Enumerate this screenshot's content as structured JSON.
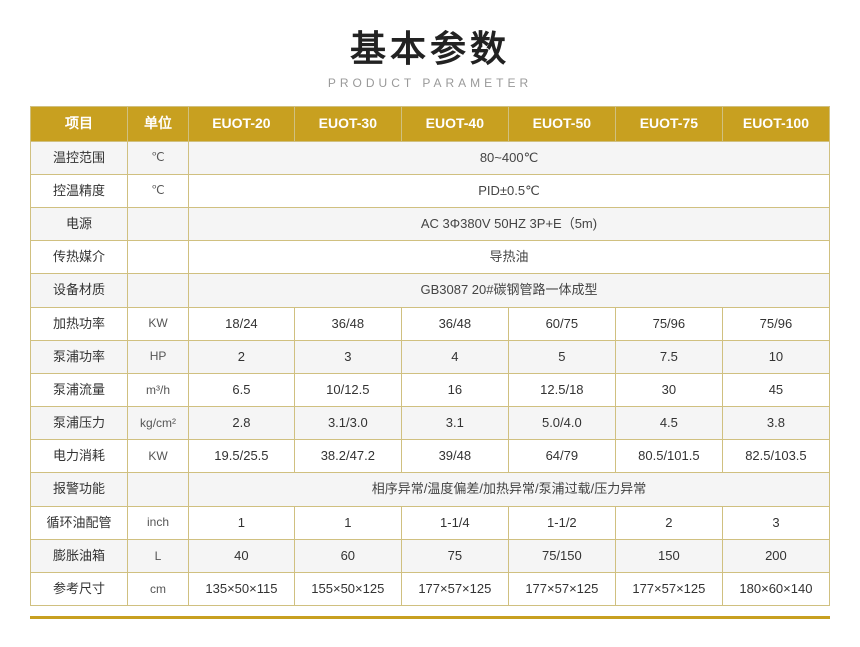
{
  "title": {
    "main": "基本参数",
    "sub": "PRODUCT PARAMETER"
  },
  "table": {
    "headers": [
      "项目",
      "单位",
      "EUOT-20",
      "EUOT-30",
      "EUOT-40",
      "EUOT-50",
      "EUOT-75",
      "EUOT-100"
    ],
    "rows": [
      {
        "label": "温控范围",
        "unit": "℃",
        "span": true,
        "spanValue": "80~400℃"
      },
      {
        "label": "控温精度",
        "unit": "℃",
        "span": true,
        "spanValue": "PID±0.5℃"
      },
      {
        "label": "电源",
        "unit": "",
        "span": true,
        "spanValue": "AC 3Φ380V 50HZ 3P+E（5m)"
      },
      {
        "label": "传热媒介",
        "unit": "",
        "span": true,
        "spanValue": "导热油"
      },
      {
        "label": "设备材质",
        "unit": "",
        "span": true,
        "spanValue": "GB3087    20#碳钢管路一体成型"
      },
      {
        "label": "加热功率",
        "unit": "KW",
        "span": false,
        "values": [
          "18/24",
          "36/48",
          "36/48",
          "60/75",
          "75/96",
          "75/96"
        ]
      },
      {
        "label": "泵浦功率",
        "unit": "HP",
        "span": false,
        "values": [
          "2",
          "3",
          "4",
          "5",
          "7.5",
          "10"
        ]
      },
      {
        "label": "泵浦流量",
        "unit": "m³/h",
        "span": false,
        "values": [
          "6.5",
          "10/12.5",
          "16",
          "12.5/18",
          "30",
          "45"
        ]
      },
      {
        "label": "泵浦压力",
        "unit": "kg/cm²",
        "span": false,
        "values": [
          "2.8",
          "3.1/3.0",
          "3.1",
          "5.0/4.0",
          "4.5",
          "3.8"
        ]
      },
      {
        "label": "电力消耗",
        "unit": "KW",
        "span": false,
        "values": [
          "19.5/25.5",
          "38.2/47.2",
          "39/48",
          "64/79",
          "80.5/101.5",
          "82.5/103.5"
        ]
      },
      {
        "label": "报警功能",
        "unit": "",
        "span": true,
        "spanValue": "相序异常/温度偏差/加热异常/泵浦过载/压力异常"
      },
      {
        "label": "循环油配管",
        "unit": "inch",
        "span": false,
        "values": [
          "1",
          "1",
          "1-1/4",
          "1-1/2",
          "2",
          "3"
        ]
      },
      {
        "label": "膨胀油箱",
        "unit": "L",
        "span": false,
        "values": [
          "40",
          "60",
          "75",
          "75/150",
          "150",
          "200"
        ]
      },
      {
        "label": "参考尺寸",
        "unit": "cm",
        "span": false,
        "values": [
          "135×50×115",
          "155×50×125",
          "177×57×125",
          "177×57×125",
          "177×57×125",
          "180×60×140"
        ]
      }
    ]
  }
}
